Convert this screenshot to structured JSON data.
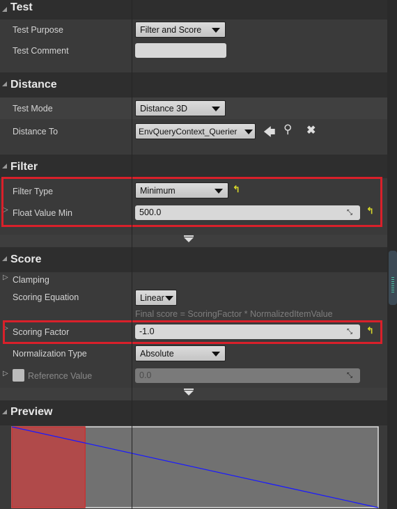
{
  "sections": {
    "test": {
      "title": "Test",
      "test_purpose_label": "Test Purpose",
      "test_purpose_value": "Filter and Score",
      "test_comment_label": "Test Comment",
      "test_comment_value": ""
    },
    "distance": {
      "title": "Distance",
      "test_mode_label": "Test Mode",
      "test_mode_value": "Distance 3D",
      "distance_to_label": "Distance To",
      "distance_to_value": "EnvQueryContext_Querier"
    },
    "filter": {
      "title": "Filter",
      "filter_type_label": "Filter Type",
      "filter_type_value": "Minimum",
      "float_value_min_label": "Float Value Min",
      "float_value_min_value": "500.0"
    },
    "score": {
      "title": "Score",
      "clamping_label": "Clamping",
      "scoring_equation_label": "Scoring Equation",
      "scoring_equation_value": "Linear",
      "hint": "Final score = ScoringFactor * NormalizedItemValue",
      "scoring_factor_label": "Scoring Factor",
      "scoring_factor_value": "-1.0",
      "normalization_type_label": "Normalization Type",
      "normalization_type_value": "Absolute",
      "reference_value_label": "Reference Value",
      "reference_value_value": "0.0"
    },
    "preview": {
      "title": "Preview"
    }
  },
  "colors": {
    "highlight": "#d9202a",
    "filtered_region": "#b04a4a",
    "score_line": "#1a1aff",
    "reset_icon": "#d6d62a"
  },
  "icons": [
    "use-selected-arrow-icon",
    "browse-search-icon",
    "clear-x-icon",
    "reset-to-default-icon",
    "drag-resize-icon"
  ],
  "preview_chart": {
    "filtered_fraction": 0.2,
    "score_start": 1,
    "score_end": 0
  }
}
